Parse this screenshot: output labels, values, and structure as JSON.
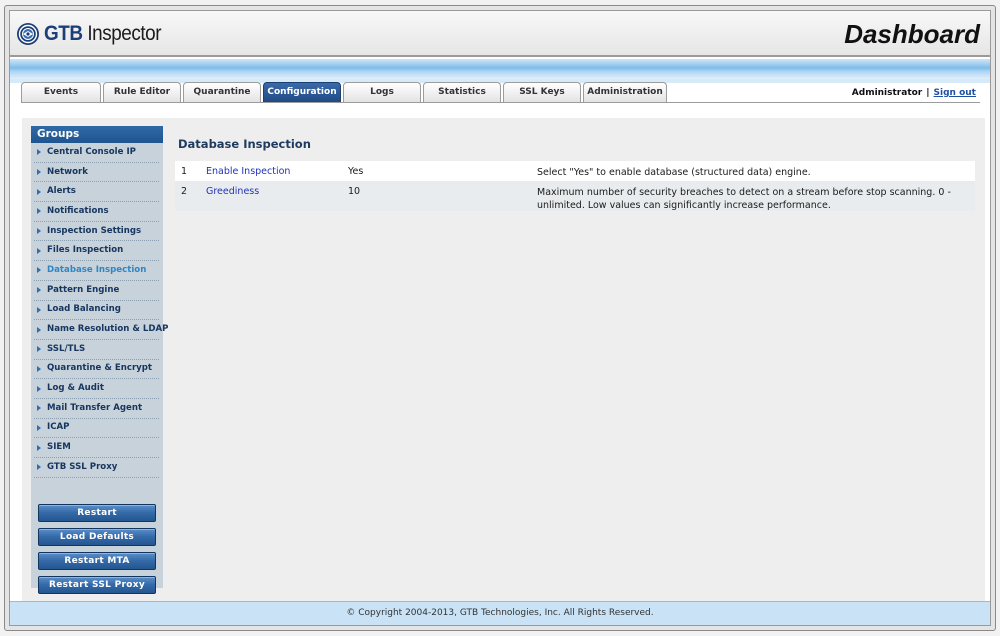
{
  "header": {
    "logo_prefix": "GTB",
    "logo_suffix": "Inspector",
    "title": "Dashboard"
  },
  "tabs": [
    {
      "label": "Events",
      "active": false
    },
    {
      "label": "Rule Editor",
      "active": false
    },
    {
      "label": "Quarantine",
      "active": false
    },
    {
      "label": "Configuration",
      "active": true
    },
    {
      "label": "Logs",
      "active": false
    },
    {
      "label": "Statistics",
      "active": false
    },
    {
      "label": "SSL Keys",
      "active": false
    },
    {
      "label": "Administration",
      "active": false
    }
  ],
  "user": {
    "name": "Administrator",
    "separator": "|",
    "signout": "Sign out"
  },
  "sidebar": {
    "heading": "Groups",
    "items": [
      {
        "label": "Central Console IP"
      },
      {
        "label": "Network"
      },
      {
        "label": "Alerts"
      },
      {
        "label": "Notifications"
      },
      {
        "label": "Inspection Settings"
      },
      {
        "label": "Files Inspection"
      },
      {
        "label": "Database Inspection",
        "active": true
      },
      {
        "label": "Pattern Engine"
      },
      {
        "label": "Load Balancing"
      },
      {
        "label": "Name Resolution & LDAP"
      },
      {
        "label": "SSL/TLS"
      },
      {
        "label": "Quarantine & Encrypt"
      },
      {
        "label": "Log & Audit"
      },
      {
        "label": "Mail Transfer Agent"
      },
      {
        "label": "ICAP"
      },
      {
        "label": "SIEM"
      },
      {
        "label": "GTB SSL Proxy"
      }
    ],
    "buttons": [
      {
        "label": "Restart"
      },
      {
        "label": "Load Defaults"
      },
      {
        "label": "Restart MTA"
      },
      {
        "label": "Restart SSL Proxy"
      }
    ]
  },
  "main": {
    "title": "Database Inspection",
    "settings": [
      {
        "num": "1",
        "name": "Enable Inspection",
        "value": "Yes",
        "desc": "Select \"Yes\" to enable database (structured data) engine."
      },
      {
        "num": "2",
        "name": "Greediness",
        "value": "10",
        "desc": "Maximum number of security breaches to detect on a stream before stop scanning. 0 - unlimited. Low values can significantly increase performance."
      }
    ]
  },
  "footer": {
    "copyright": "© Copyright 2004-2013, GTB Technologies, Inc. All Rights Reserved."
  },
  "colors": {
    "accent": "#1f4a85",
    "link": "#2233b8",
    "active_side_item": "#2f86c5"
  }
}
